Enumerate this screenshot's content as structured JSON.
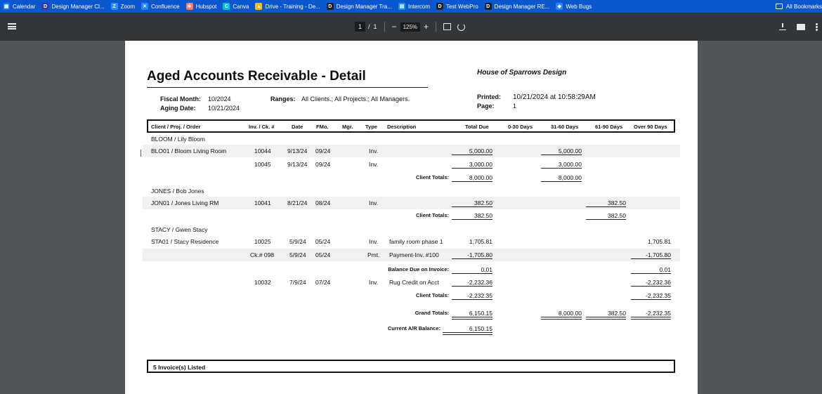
{
  "bookmarks": [
    {
      "label": "Calendar",
      "icon": "calendar-icon",
      "color": "#1a73e8",
      "glyph": "▦"
    },
    {
      "label": "Design Manager Cl...",
      "icon": "dm-icon",
      "color": "#3b3b9e",
      "glyph": "D"
    },
    {
      "label": "Zoom",
      "icon": "zoom-icon",
      "color": "#2d8cff",
      "glyph": "Z"
    },
    {
      "label": "Confluence",
      "icon": "confluence-icon",
      "color": "#2684ff",
      "glyph": "✕"
    },
    {
      "label": "Hubspot",
      "icon": "hubspot-icon",
      "color": "#ff7a59",
      "glyph": "✻"
    },
    {
      "label": "Canva",
      "icon": "canva-icon",
      "color": "#00c4cc",
      "glyph": "C"
    },
    {
      "label": "Drive - Training - De...",
      "icon": "drive-icon",
      "color": "#fbbc04",
      "glyph": "▲"
    },
    {
      "label": "Design Manager Tra...",
      "icon": "dm-icon",
      "color": "#222222",
      "glyph": "D"
    },
    {
      "label": "Intercom",
      "icon": "intercom-icon",
      "color": "#1f8ded",
      "glyph": "▤"
    },
    {
      "label": "Test WebPro",
      "icon": "dm-icon",
      "color": "#222222",
      "glyph": "D"
    },
    {
      "label": "Design Manager RE...",
      "icon": "dm-icon",
      "color": "#222222",
      "glyph": "D"
    },
    {
      "label": "Web Bugs",
      "icon": "jira-icon",
      "color": "#2684ff",
      "glyph": "◆"
    }
  ],
  "bookmarks_right": "All Bookmarks",
  "toolbar": {
    "page_current": "1",
    "page_sep": "/",
    "page_total": "1",
    "zoom": "125%",
    "minus": "−",
    "plus": "+"
  },
  "report": {
    "title": "Aged Accounts Receivable - Detail",
    "company": "House of Sparrows Design",
    "fiscal_month_label": "Fiscal Month:",
    "fiscal_month": "10/2024",
    "aging_date_label": "Aging Date:",
    "aging_date": "10/21/2024",
    "ranges_label": "Ranges:",
    "ranges": "All Clients.; All Projects.; All Managers.",
    "printed_label": "Printed:",
    "printed": "10/21/2024 at 10:58:29AM",
    "page_label": "Page:",
    "page": "1"
  },
  "columns": {
    "client": "Client / Proj. / Order",
    "inv": "Inv. / Ck. #",
    "date": "Date",
    "fmo": "FMo.",
    "mgr": "Mgr.",
    "type": "Type",
    "desc": "Description",
    "total": "Total Due",
    "d0_30": "0-30 Days",
    "d31_60": "31-60 Days",
    "d61_90": "61-90 Days",
    "over90": "Over 90 Days"
  },
  "groups": {
    "bloom": {
      "client": "BLOOM / Lily Bloom",
      "row1": {
        "proj": "BLO01 / Bloom Living Room",
        "inv": "10044",
        "date": "9/13/24",
        "fmo": "09/24",
        "type": "Inv.",
        "total": "5,000.00",
        "d31_60": "5,000.00"
      },
      "row2": {
        "inv": "10045",
        "date": "9/13/24",
        "fmo": "09/24",
        "type": "Inv.",
        "total": "3,000.00",
        "d31_60": "3,000.00"
      },
      "totals_label": "Client Totals:",
      "total": "8,000.00",
      "d31_60": "8,000.00"
    },
    "jones": {
      "client": "JONES / Bob Jones",
      "row1": {
        "proj": "JON01 / Jones Living RM",
        "inv": "10041",
        "date": "8/21/24",
        "fmo": "08/24",
        "type": "Inv.",
        "total": "382.50",
        "d61_90": "382.50"
      },
      "totals_label": "Client Totals:",
      "total": "382.50",
      "d61_90": "382.50"
    },
    "stacy": {
      "client": "STACY / Gwen Stacy",
      "row1": {
        "proj": "STA01 / Stacy Residence",
        "inv": "10025",
        "date": "5/9/24",
        "fmo": "05/24",
        "type": "Inv.",
        "desc": "family room phase 1",
        "total": "1,705.81",
        "over90": "1,705.81"
      },
      "row2": {
        "inv": "Ck.# 098",
        "date": "5/9/24",
        "fmo": "05/24",
        "type": "Pmt.",
        "desc": "Payment-Inv. #100",
        "total": "-1,705.80",
        "over90": "-1,705.80"
      },
      "balance_label": "Balance Due on Invoice:",
      "balance_total": "0.01",
      "balance_over90": "0.01",
      "row3": {
        "inv": "10032",
        "date": "7/9/24",
        "fmo": "07/24",
        "type": "Inv.",
        "desc": "Rug Credit on Acct",
        "total": "-2,232.36",
        "over90": "-2,232.36"
      },
      "totals_label": "Client Totals:",
      "total": "-2,232.35",
      "over90": "-2,232.35"
    }
  },
  "grand": {
    "label": "Grand Totals:",
    "total": "6,150.15",
    "d31_60": "8,000.00",
    "d61_90": "382.50",
    "over90": "-2,232.35"
  },
  "current": {
    "label": "Current A/R Balance:",
    "value": "6,150.15"
  },
  "footer": "5 Invoice(s) Listed"
}
